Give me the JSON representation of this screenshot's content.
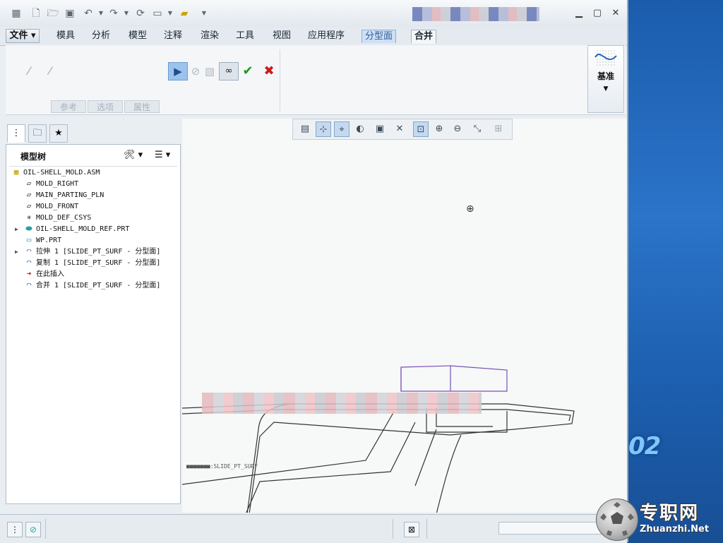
{
  "menu": {
    "file": "文件",
    "items": [
      "模具",
      "分析",
      "模型",
      "注释",
      "渲染",
      "工具",
      "视图",
      "应用程序"
    ],
    "active_tab": "分型面",
    "current_tab": "合并"
  },
  "ribbon": {
    "tabs": [
      "参考",
      "选项",
      "属性"
    ],
    "datum_label": "基准"
  },
  "model_tree": {
    "title": "模型树",
    "items": [
      {
        "label": "OIL-SHELL_MOLD.ASM",
        "icon": "assembly-icon"
      },
      {
        "label": "MOLD_RIGHT",
        "icon": "datum-plane-icon"
      },
      {
        "label": "MAIN_PARTING_PLN",
        "icon": "datum-plane-icon"
      },
      {
        "label": "MOLD_FRONT",
        "icon": "datum-plane-icon"
      },
      {
        "label": "MOLD_DEF_CSYS",
        "icon": "csys-icon"
      },
      {
        "label": "OIL-SHELL_MOLD_REF.PRT",
        "icon": "part-icon",
        "expandable": true
      },
      {
        "label": "WP.PRT",
        "icon": "workpiece-icon"
      },
      {
        "label": "拉伸 1 [SLIDE_PT_SURF - 分型面]",
        "icon": "surface-icon",
        "expandable": true
      },
      {
        "label": "复制 1 [SLIDE_PT_SURF - 分型面]",
        "icon": "surface-icon"
      },
      {
        "label": "在此插入",
        "icon": "insert-here-icon"
      },
      {
        "label": "合并 1 [SLIDE_PT_SURF - 分型面]",
        "icon": "merge-surface-icon"
      }
    ]
  },
  "viewport": {
    "surface_label": "SLIDE_PT_SURF"
  },
  "desktop": {
    "number": "02",
    "watermark_cn": "专职网",
    "watermark_en": "Zhuanzhi.Net"
  },
  "colors": {
    "accept": "#1a9a1a",
    "cancel": "#cc1a1a",
    "active_blue": "#9cc3ec",
    "desktop_blue": "#2b74c9"
  }
}
